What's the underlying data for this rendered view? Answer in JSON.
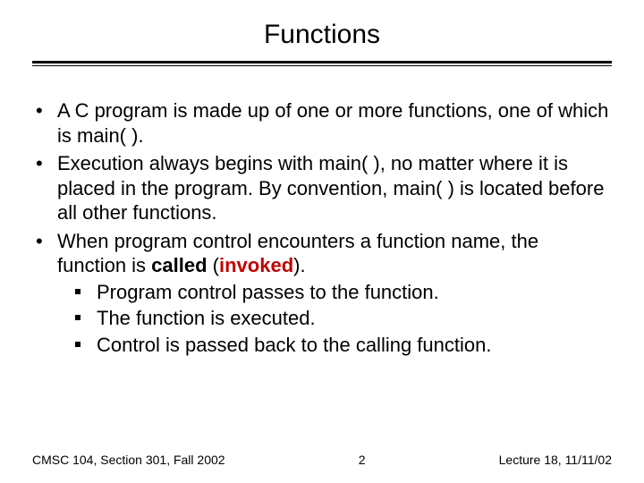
{
  "title": "Functions",
  "bullets": {
    "b1": "A C program is made up of one or more functions, one of which is main( ).",
    "b2": "Execution always begins with main( ), no matter where it is placed in the program.  By convention, main( ) is located before all other functions.",
    "b3_pre": "When program control encounters a function name, the function is ",
    "b3_called": "called",
    "b3_paren_open": " (",
    "b3_invoked": "invoked",
    "b3_paren_close": ").",
    "sub1": "Program control passes to the function.",
    "sub2": "The function is executed.",
    "sub3": "Control is passed back to the calling function."
  },
  "footer": {
    "left": "CMSC 104, Section 301, Fall 2002",
    "center": "2",
    "right": "Lecture 18, 11/11/02"
  },
  "colors": {
    "invoked": "#c00000"
  }
}
